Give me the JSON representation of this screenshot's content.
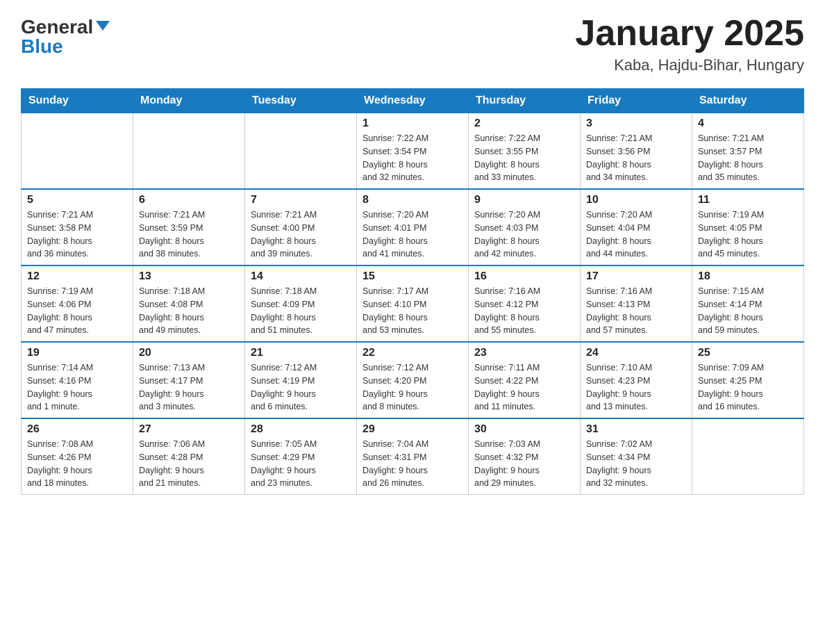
{
  "header": {
    "logo_general": "General",
    "logo_blue": "Blue",
    "title": "January 2025",
    "subtitle": "Kaba, Hajdu-Bihar, Hungary"
  },
  "days_of_week": [
    "Sunday",
    "Monday",
    "Tuesday",
    "Wednesday",
    "Thursday",
    "Friday",
    "Saturday"
  ],
  "weeks": [
    [
      {
        "day": "",
        "info": ""
      },
      {
        "day": "",
        "info": ""
      },
      {
        "day": "",
        "info": ""
      },
      {
        "day": "1",
        "info": "Sunrise: 7:22 AM\nSunset: 3:54 PM\nDaylight: 8 hours\nand 32 minutes."
      },
      {
        "day": "2",
        "info": "Sunrise: 7:22 AM\nSunset: 3:55 PM\nDaylight: 8 hours\nand 33 minutes."
      },
      {
        "day": "3",
        "info": "Sunrise: 7:21 AM\nSunset: 3:56 PM\nDaylight: 8 hours\nand 34 minutes."
      },
      {
        "day": "4",
        "info": "Sunrise: 7:21 AM\nSunset: 3:57 PM\nDaylight: 8 hours\nand 35 minutes."
      }
    ],
    [
      {
        "day": "5",
        "info": "Sunrise: 7:21 AM\nSunset: 3:58 PM\nDaylight: 8 hours\nand 36 minutes."
      },
      {
        "day": "6",
        "info": "Sunrise: 7:21 AM\nSunset: 3:59 PM\nDaylight: 8 hours\nand 38 minutes."
      },
      {
        "day": "7",
        "info": "Sunrise: 7:21 AM\nSunset: 4:00 PM\nDaylight: 8 hours\nand 39 minutes."
      },
      {
        "day": "8",
        "info": "Sunrise: 7:20 AM\nSunset: 4:01 PM\nDaylight: 8 hours\nand 41 minutes."
      },
      {
        "day": "9",
        "info": "Sunrise: 7:20 AM\nSunset: 4:03 PM\nDaylight: 8 hours\nand 42 minutes."
      },
      {
        "day": "10",
        "info": "Sunrise: 7:20 AM\nSunset: 4:04 PM\nDaylight: 8 hours\nand 44 minutes."
      },
      {
        "day": "11",
        "info": "Sunrise: 7:19 AM\nSunset: 4:05 PM\nDaylight: 8 hours\nand 45 minutes."
      }
    ],
    [
      {
        "day": "12",
        "info": "Sunrise: 7:19 AM\nSunset: 4:06 PM\nDaylight: 8 hours\nand 47 minutes."
      },
      {
        "day": "13",
        "info": "Sunrise: 7:18 AM\nSunset: 4:08 PM\nDaylight: 8 hours\nand 49 minutes."
      },
      {
        "day": "14",
        "info": "Sunrise: 7:18 AM\nSunset: 4:09 PM\nDaylight: 8 hours\nand 51 minutes."
      },
      {
        "day": "15",
        "info": "Sunrise: 7:17 AM\nSunset: 4:10 PM\nDaylight: 8 hours\nand 53 minutes."
      },
      {
        "day": "16",
        "info": "Sunrise: 7:16 AM\nSunset: 4:12 PM\nDaylight: 8 hours\nand 55 minutes."
      },
      {
        "day": "17",
        "info": "Sunrise: 7:16 AM\nSunset: 4:13 PM\nDaylight: 8 hours\nand 57 minutes."
      },
      {
        "day": "18",
        "info": "Sunrise: 7:15 AM\nSunset: 4:14 PM\nDaylight: 8 hours\nand 59 minutes."
      }
    ],
    [
      {
        "day": "19",
        "info": "Sunrise: 7:14 AM\nSunset: 4:16 PM\nDaylight: 9 hours\nand 1 minute."
      },
      {
        "day": "20",
        "info": "Sunrise: 7:13 AM\nSunset: 4:17 PM\nDaylight: 9 hours\nand 3 minutes."
      },
      {
        "day": "21",
        "info": "Sunrise: 7:12 AM\nSunset: 4:19 PM\nDaylight: 9 hours\nand 6 minutes."
      },
      {
        "day": "22",
        "info": "Sunrise: 7:12 AM\nSunset: 4:20 PM\nDaylight: 9 hours\nand 8 minutes."
      },
      {
        "day": "23",
        "info": "Sunrise: 7:11 AM\nSunset: 4:22 PM\nDaylight: 9 hours\nand 11 minutes."
      },
      {
        "day": "24",
        "info": "Sunrise: 7:10 AM\nSunset: 4:23 PM\nDaylight: 9 hours\nand 13 minutes."
      },
      {
        "day": "25",
        "info": "Sunrise: 7:09 AM\nSunset: 4:25 PM\nDaylight: 9 hours\nand 16 minutes."
      }
    ],
    [
      {
        "day": "26",
        "info": "Sunrise: 7:08 AM\nSunset: 4:26 PM\nDaylight: 9 hours\nand 18 minutes."
      },
      {
        "day": "27",
        "info": "Sunrise: 7:06 AM\nSunset: 4:28 PM\nDaylight: 9 hours\nand 21 minutes."
      },
      {
        "day": "28",
        "info": "Sunrise: 7:05 AM\nSunset: 4:29 PM\nDaylight: 9 hours\nand 23 minutes."
      },
      {
        "day": "29",
        "info": "Sunrise: 7:04 AM\nSunset: 4:31 PM\nDaylight: 9 hours\nand 26 minutes."
      },
      {
        "day": "30",
        "info": "Sunrise: 7:03 AM\nSunset: 4:32 PM\nDaylight: 9 hours\nand 29 minutes."
      },
      {
        "day": "31",
        "info": "Sunrise: 7:02 AM\nSunset: 4:34 PM\nDaylight: 9 hours\nand 32 minutes."
      },
      {
        "day": "",
        "info": ""
      }
    ]
  ]
}
